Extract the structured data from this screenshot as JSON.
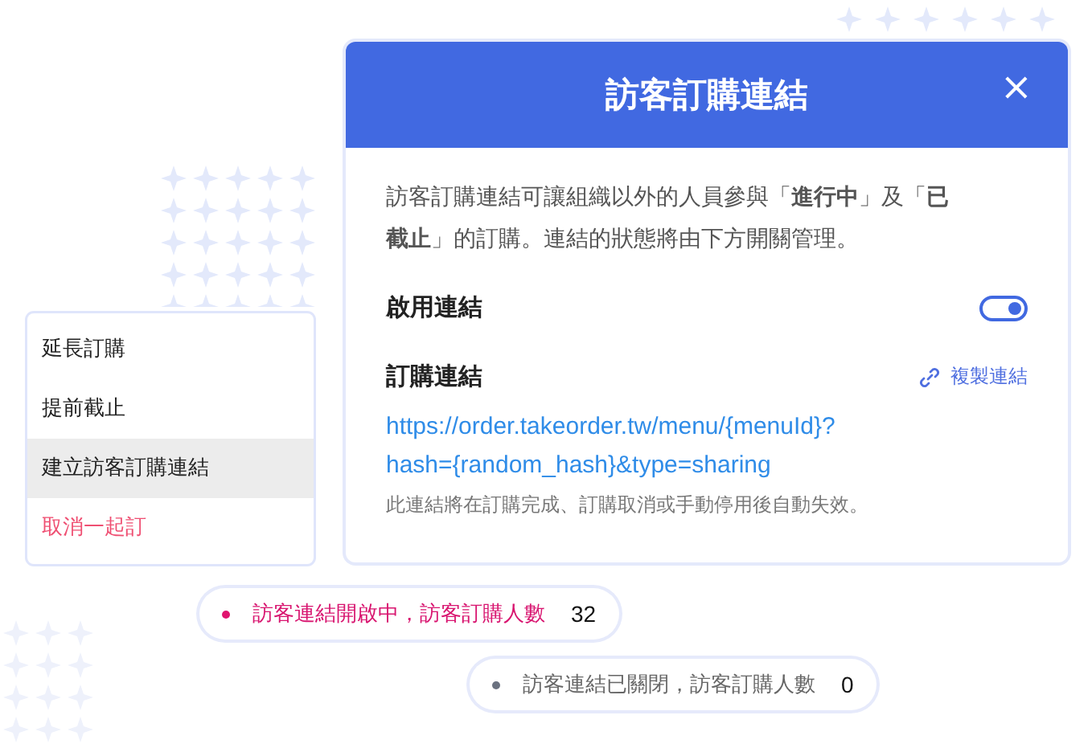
{
  "dialog": {
    "title": "訪客訂購連結",
    "close": "×",
    "description": "訪客訂購連結可讓組織以外的人員參與「**進行中**」及「**已截止**」的訂購。連結的狀態將由下方開關管理。",
    "toggle": {
      "label": "啟用連結",
      "on": true
    },
    "link": {
      "label": "訂購連結",
      "copy": "複製連結",
      "url_lines": [
        "https://order.takeorder.tw/menu/{menuId}?",
        "hash={random_hash}&type=sharing"
      ],
      "note": "此連結將在訂購完成、訂購取消或手動停用後自動失效。"
    }
  },
  "menu": {
    "items": [
      {
        "label": "延長訂購",
        "kind": "normal",
        "selected": false
      },
      {
        "label": "提前截止",
        "kind": "normal",
        "selected": false
      },
      {
        "label": "建立訪客訂購連結",
        "kind": "normal",
        "selected": true
      },
      {
        "label": "取消一起訂",
        "kind": "danger",
        "selected": false
      }
    ]
  },
  "statuses": [
    {
      "text": "訪客連結開啟中，訪客訂購人數",
      "count": "32",
      "active": true,
      "color": "#e0156f"
    },
    {
      "text": "訪客連結已關閉，訪客訂購人數",
      "count": "0",
      "active": false,
      "color": "#6b7280"
    }
  ]
}
